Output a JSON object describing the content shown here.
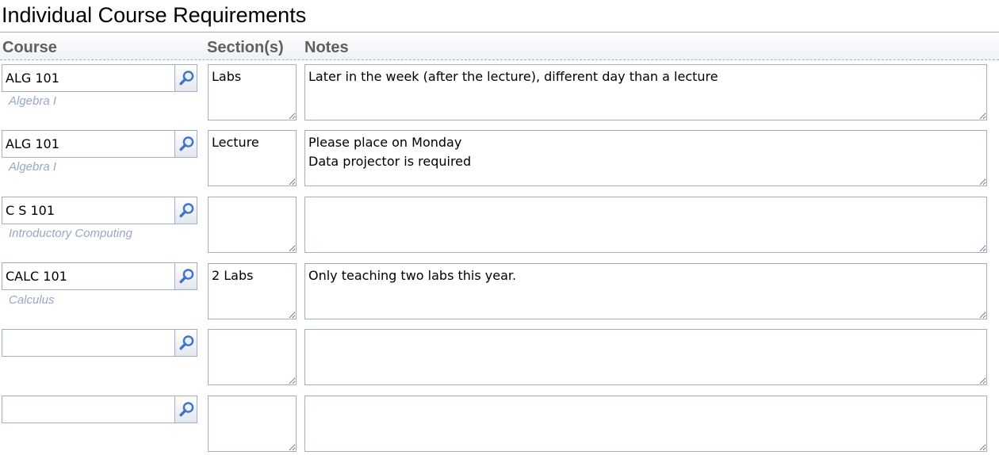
{
  "page": {
    "title": "Individual Course Requirements"
  },
  "table": {
    "headers": {
      "course": "Course",
      "sections": "Section(s)",
      "notes": "Notes"
    },
    "rows": [
      {
        "course": "ALG 101",
        "description": "Algebra I",
        "sections": "Labs",
        "notes": "Later in the week (after the lecture), different day than a lecture"
      },
      {
        "course": "ALG 101",
        "description": "Algebra I",
        "sections": "Lecture",
        "notes": "Please place on Monday\nData projector is required"
      },
      {
        "course": "C S 101",
        "description": "Introductory Computing",
        "sections": "",
        "notes": ""
      },
      {
        "course": "CALC 101",
        "description": "Calculus",
        "sections": "2 Labs",
        "notes": "Only teaching two labs this year."
      },
      {
        "course": "",
        "description": "",
        "sections": "",
        "notes": ""
      },
      {
        "course": "",
        "description": "",
        "sections": "",
        "notes": ""
      }
    ]
  },
  "icons": {
    "lookup": "magnifier-icon"
  },
  "colors": {
    "border": "#9fb0c6",
    "description_text": "#97a8c2",
    "header_text": "#5f5f5f",
    "icon_blue": "#3f73c9"
  }
}
